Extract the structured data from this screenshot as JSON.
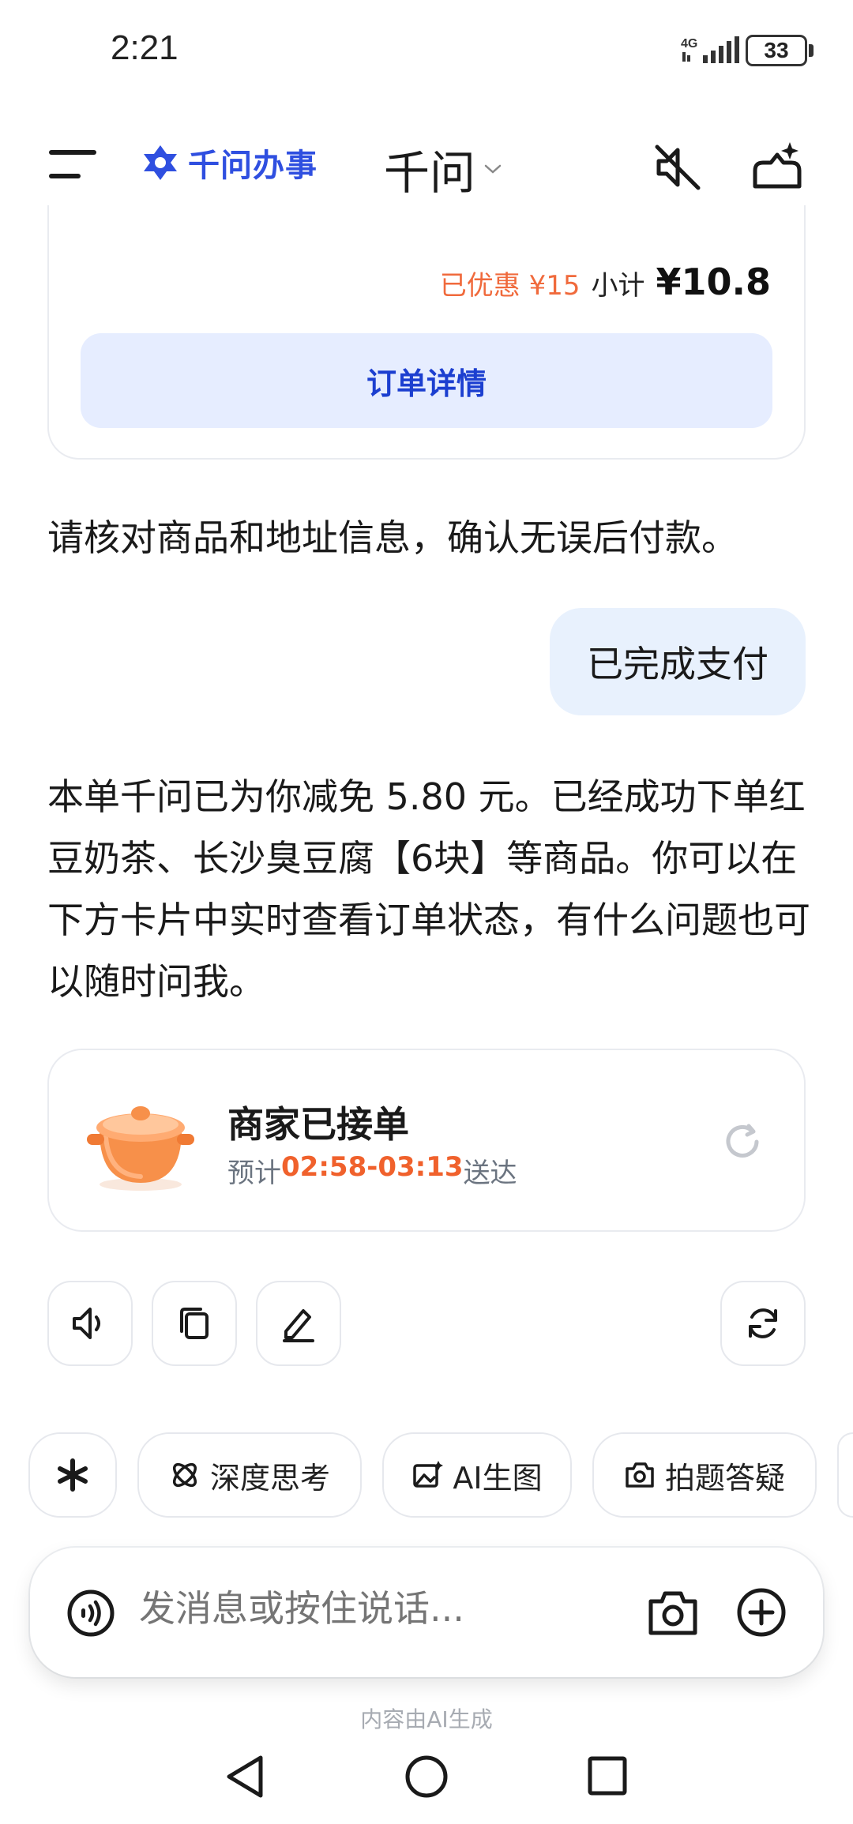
{
  "status_bar": {
    "time": "2:21",
    "network": "4G",
    "battery": "33"
  },
  "header": {
    "brand": "千问办事",
    "title": "千问"
  },
  "order_card": {
    "discount": "已优惠 ¥15",
    "subtotal_label": "小计",
    "subtotal_value": "¥10.8",
    "detail_button": "订单详情"
  },
  "messages": {
    "assistant_1": "请核对商品和地址信息，确认无误后付款。",
    "user_1": "已完成支付",
    "assistant_2": "本单千问已为你减免 5.80 元。已经成功下单红豆奶茶、长沙臭豆腐【6块】等商品。你可以在下方卡片中实时查看订单状态，有什么问题也可以随时问我。"
  },
  "status_card": {
    "title": "商家已接单",
    "eta_prefix": "预计",
    "eta_time": "02:58-03:13",
    "eta_suffix": "送达"
  },
  "actions": [
    "speaker-icon",
    "copy-icon",
    "edit-icon",
    "regenerate-icon"
  ],
  "chips": [
    {
      "label": "",
      "icon": "sparkle-icon"
    },
    {
      "label": "深度思考",
      "icon": "atom-icon"
    },
    {
      "label": "AI生图",
      "icon": "image-icon"
    },
    {
      "label": "拍题答疑",
      "icon": "camera-icon"
    }
  ],
  "input": {
    "placeholder": "发消息或按住说话..."
  },
  "footnote": "内容由AI生成",
  "colors": {
    "accent": "#2f4fe0",
    "discount": "#f06a3c",
    "eta": "#f0612c",
    "bubble": "#e8f1fd",
    "button_bg": "#e6edff"
  }
}
